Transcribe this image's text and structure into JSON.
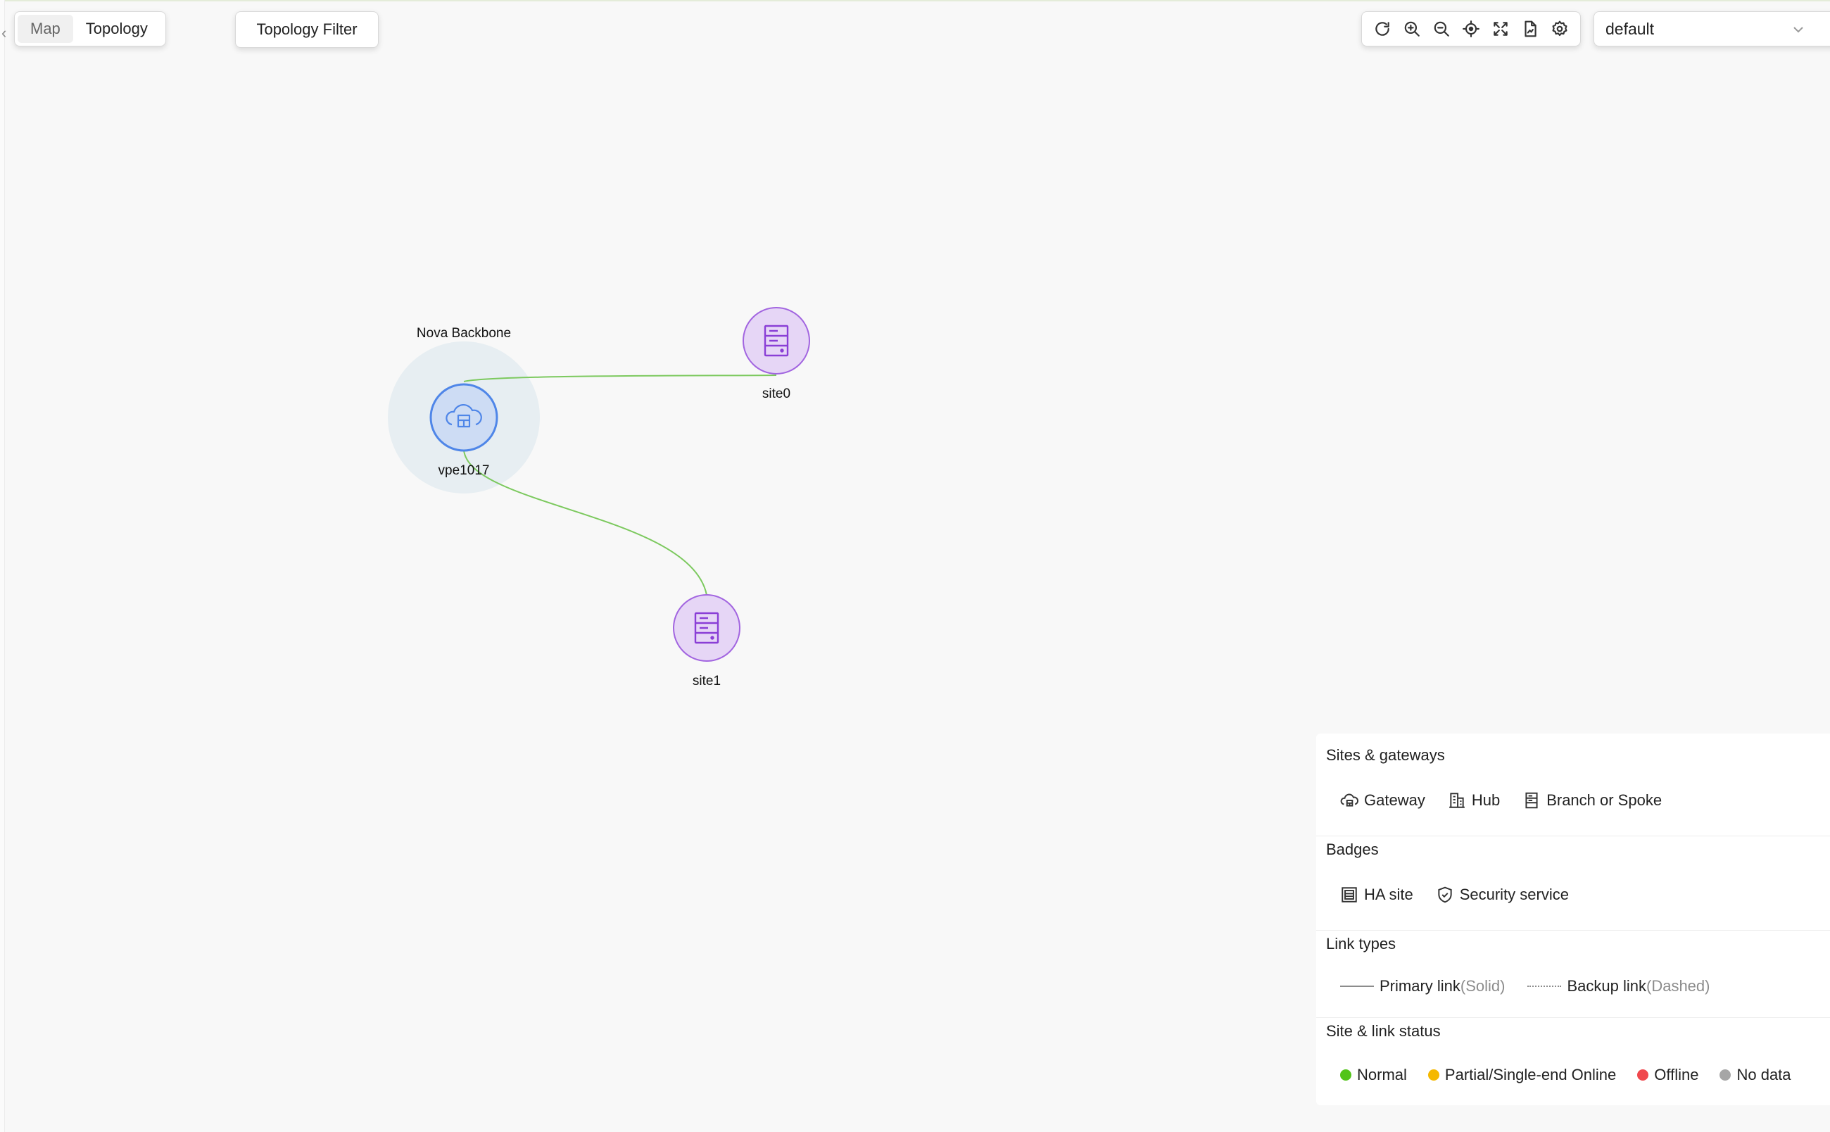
{
  "view_toggle": {
    "map": "Map",
    "topology": "Topology",
    "selected": "Topology"
  },
  "filter": {
    "label": "Topology Filter"
  },
  "toolbar": {
    "tools": [
      {
        "name": "refresh-icon"
      },
      {
        "name": "zoom-in-icon"
      },
      {
        "name": "zoom-out-icon"
      },
      {
        "name": "locate-icon"
      },
      {
        "name": "fit-screen-icon"
      },
      {
        "name": "export-icon"
      },
      {
        "name": "settings-icon"
      }
    ]
  },
  "select": {
    "value": "default"
  },
  "topology": {
    "group": {
      "label": "Nova Backbone"
    },
    "nodes": [
      {
        "id": "vpe1017",
        "label": "vpe1017",
        "type": "gateway"
      },
      {
        "id": "site0",
        "label": "site0",
        "type": "branch"
      },
      {
        "id": "site1",
        "label": "site1",
        "type": "branch"
      }
    ],
    "links": [
      {
        "from": "vpe1017",
        "to": "site0",
        "type": "primary",
        "status": "normal"
      },
      {
        "from": "vpe1017",
        "to": "site1",
        "type": "primary",
        "status": "normal"
      }
    ],
    "colors": {
      "link_normal": "#7cc95e",
      "gateway_fill": "#cddcf4",
      "gateway_stroke": "#4f86e8",
      "group_bg": "#e7eef2",
      "branch_fill": "#e6d6f6",
      "branch_stroke": "#a265e0",
      "branch_icon": "#8a3fd6"
    }
  },
  "legend": {
    "sites": {
      "title": "Sites & gateways",
      "items": [
        {
          "label": "Gateway",
          "icon": "cloud-gateway-icon"
        },
        {
          "label": "Hub",
          "icon": "building-hub-icon"
        },
        {
          "label": "Branch or Spoke",
          "icon": "server-branch-icon"
        }
      ]
    },
    "badges": {
      "title": "Badges",
      "items": [
        {
          "label": "HA site",
          "icon": "ha-site-icon"
        },
        {
          "label": "Security service",
          "icon": "shield-icon"
        }
      ]
    },
    "link_types": {
      "title": "Link types",
      "primary": {
        "label": "Primary link",
        "note": "(Solid)"
      },
      "backup": {
        "label": "Backup link",
        "note": "(Dashed)"
      }
    },
    "status": {
      "title": "Site & link status",
      "items": [
        {
          "label": "Normal",
          "color": "#52c41a"
        },
        {
          "label": "Partial/Single-end Online",
          "color": "#f5b800"
        },
        {
          "label": "Offline",
          "color": "#f0484d"
        },
        {
          "label": "No data",
          "color": "#a6a6a6"
        }
      ]
    }
  }
}
